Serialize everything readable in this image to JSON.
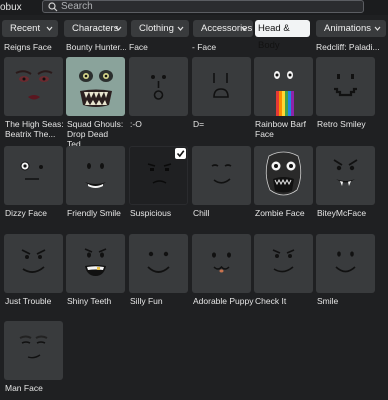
{
  "header": {
    "robux_label": "obux",
    "search_placeholder": "Search"
  },
  "tabs": [
    {
      "label": "Recent",
      "active": false
    },
    {
      "label": "Characters",
      "active": false
    },
    {
      "label": "Clothing",
      "active": false
    },
    {
      "label": "Accessories",
      "active": false
    },
    {
      "label": "Head & Body",
      "active": true
    },
    {
      "label": "Animations",
      "active": false
    }
  ],
  "partial_row": [
    "Reigns Face",
    "Bounty Hunter...",
    "Face",
    "- Face",
    "",
    "Redcliff: Paladi..."
  ],
  "items": [
    {
      "name": "The High Seas: Beatrix The...",
      "icon": "beatrix-face-icon"
    },
    {
      "name": "Squad Ghouls: Drop Dead Ted...",
      "icon": "ghoul-face-icon"
    },
    {
      "name": ":-O",
      "icon": "surprised-face-icon"
    },
    {
      "name": "D=",
      "icon": "d-equals-face-icon"
    },
    {
      "name": "Rainbow Barf Face",
      "icon": "rainbow-barf-face-icon"
    },
    {
      "name": "Retro Smiley",
      "icon": "retro-smiley-face-icon"
    },
    {
      "name": "Dizzy Face",
      "icon": "dizzy-face-icon"
    },
    {
      "name": "Friendly Smile",
      "icon": "friendly-smile-face-icon"
    },
    {
      "name": "Suspicious",
      "icon": "suspicious-face-icon",
      "selected": true
    },
    {
      "name": "Chill",
      "icon": "chill-face-icon"
    },
    {
      "name": "Zombie Face",
      "icon": "zombie-face-icon"
    },
    {
      "name": "BiteyMcFace",
      "icon": "bitey-face-icon"
    },
    {
      "name": "Just Trouble",
      "icon": "just-trouble-face-icon"
    },
    {
      "name": "Shiny Teeth",
      "icon": "shiny-teeth-face-icon"
    },
    {
      "name": "Silly Fun",
      "icon": "silly-fun-face-icon"
    },
    {
      "name": "Adorable Puppy",
      "icon": "adorable-puppy-face-icon"
    },
    {
      "name": "Check It",
      "icon": "check-it-face-icon"
    },
    {
      "name": "Smile",
      "icon": "smile-face-icon"
    },
    {
      "name": "Man Face",
      "icon": "man-face-icon"
    }
  ],
  "colors": {
    "background": "#1f2022",
    "tile": "#393b3d",
    "active_tab": "#f2f4f5",
    "ghoul_tile": "#8aa39b"
  }
}
